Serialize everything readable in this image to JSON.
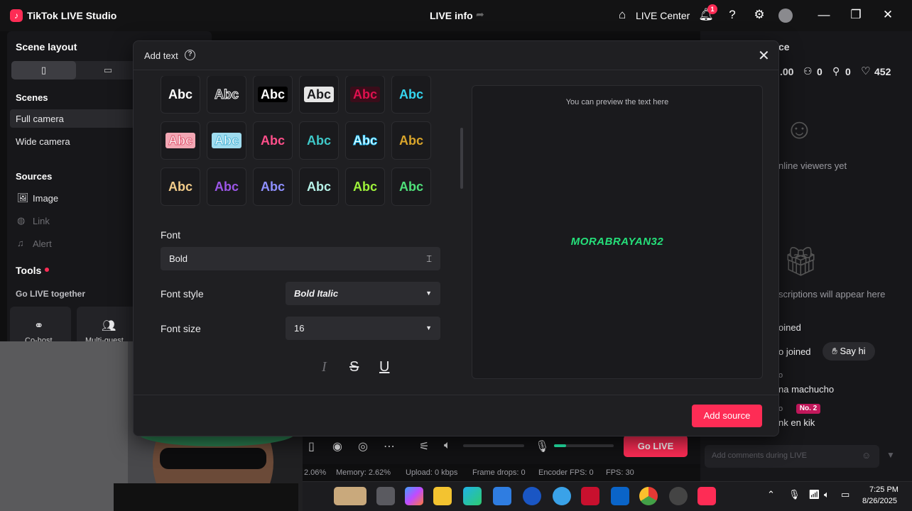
{
  "app": {
    "title": "TikTok LIVE Studio",
    "logo_glyph": "♪",
    "center_title": "LIVE info",
    "live_center": "LIVE Center",
    "notification_count": "1"
  },
  "left": {
    "scene_layout": "Scene layout",
    "scenes_heading": "Scenes",
    "scenes": [
      "Full camera",
      "Wide camera"
    ],
    "sources_heading": "Sources",
    "sources": [
      {
        "label": "Image",
        "icon": "image-icon"
      },
      {
        "label": "Link",
        "icon": "globe-icon"
      },
      {
        "label": "Alert",
        "icon": "bell-icon"
      }
    ],
    "tools_heading": "Tools",
    "go_live_together": "Go LIVE together",
    "tools": [
      "Co-host",
      "Multi-guest"
    ]
  },
  "right": {
    "title_fragment": "ce",
    "stats": [
      ".00",
      "0",
      "0",
      "452"
    ],
    "no_viewers": "nline viewers yet",
    "subscriptions": "scriptions will appear here",
    "feed": {
      "joined_header": "oined",
      "joined_line": "o joined",
      "say_hi": "Say hi",
      "user1": "o",
      "msg1": "na machucho",
      "user2": "o",
      "badge": "No. 2",
      "msg2": "nk en kik"
    },
    "comment_placeholder": "Add comments during LIVE"
  },
  "modal": {
    "title": "Add text",
    "styles_rows": [
      [
        {
          "text": "Abc",
          "color": "#ffffff",
          "bg": "",
          "stroke": ""
        },
        {
          "text": "Abc",
          "color": "#1a1a1d",
          "bg": "",
          "stroke": "#ffffff"
        },
        {
          "text": "Abc",
          "color": "#ffffff",
          "bg": "#000000",
          "stroke": ""
        },
        {
          "text": "Abc",
          "color": "#1a1a1d",
          "bg": "#e6e6e6",
          "stroke": ""
        },
        {
          "text": "Abc",
          "color": "#e0114f",
          "bg": "#3a0d1a",
          "stroke": ""
        },
        {
          "text": "Abc",
          "color": "#35d6f0",
          "bg": "",
          "stroke": ""
        }
      ],
      [
        {
          "text": "Abc",
          "color": "#ffffff",
          "bg": "#f3a7b4",
          "stroke": "#e05a72"
        },
        {
          "text": "Abc",
          "color": "#ffffff",
          "bg": "#9fdcef",
          "stroke": "#4cb4d6"
        },
        {
          "text": "Abc",
          "color": "#ff4f8a",
          "bg": "",
          "stroke": ""
        },
        {
          "text": "Abc",
          "color": "#3fc9c9",
          "bg": "",
          "stroke": ""
        },
        {
          "text": "Abc",
          "color": "#ffffff",
          "bg": "",
          "stroke": "#28c6ff"
        },
        {
          "text": "Abc",
          "color": "#d9a52b",
          "bg": "",
          "stroke": ""
        }
      ],
      [
        {
          "text": "Abc",
          "color": "#f2cc8a",
          "bg": "",
          "stroke": ""
        },
        {
          "text": "Abc",
          "color": "#9c56e8",
          "bg": "",
          "stroke": ""
        },
        {
          "text": "Abc",
          "color": "#8f90ff",
          "bg": "",
          "stroke": ""
        },
        {
          "text": "Abc",
          "color": "#b6f2e8",
          "bg": "",
          "stroke": ""
        },
        {
          "text": "Abc",
          "color": "#9ef23a",
          "bg": "",
          "stroke": ""
        },
        {
          "text": "Abc",
          "color": "#4fe07a",
          "bg": "",
          "stroke": ""
        }
      ]
    ],
    "font_label": "Font",
    "font_value": "Bold",
    "font_style_label": "Font style",
    "font_style_value": "Bold Italic",
    "font_size_label": "Font size",
    "font_size_value": "16",
    "preview_hint": "You can preview the text here",
    "preview_text": "MORABRAYAN32",
    "preview_color": "#25e07a",
    "add_source": "Add source"
  },
  "controls": {
    "go_live": "Go LIVE",
    "mic_level": 0.2,
    "status": {
      "cpu": "2.06%",
      "memory": "Memory: 2.62%",
      "upload": "Upload: 0 kbps",
      "frame_drops": "Frame drops: 0",
      "encoder_fps": "Encoder FPS: 0",
      "fps": "FPS: 30"
    }
  },
  "taskbar": {
    "time": "7:25 PM",
    "date": "8/26/2025"
  },
  "colors": {
    "accent": "#fe2c55",
    "bg": "#0f0f10",
    "panel": "#17171a",
    "modal": "#1f1f22"
  }
}
